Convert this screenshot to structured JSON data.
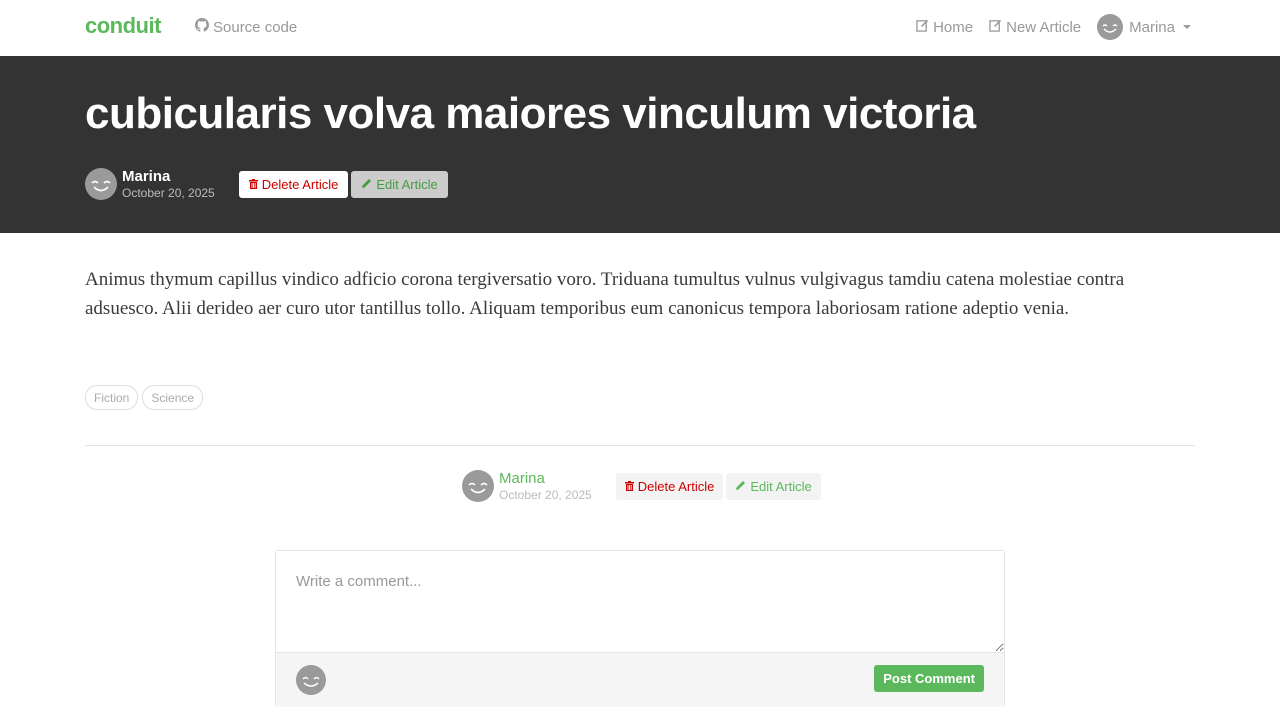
{
  "navbar": {
    "brand": "conduit",
    "source_code": "Source code",
    "links": [
      {
        "label": "Home"
      },
      {
        "label": "New Article"
      }
    ],
    "user": "Marina"
  },
  "article": {
    "title": "cubicularis volva maiores vinculum victoria",
    "author": "Marina",
    "date": "October 20, 2025",
    "delete_label": "Delete Article",
    "edit_label": "Edit Article",
    "body": "Animus thymum capillus vindico adficio corona tergiversatio voro. Triduana tumultus vulnus vulgivagus tamdiu catena molestiae contra adsuesco. Alii derideo aer curo utor tantillus tollo. Aliquam temporibus eum canonicus tempora laboriosam ratione adeptio venia.",
    "tags": [
      "Fiction",
      "Science"
    ]
  },
  "comment": {
    "placeholder": "Write a comment...",
    "post_label": "Post Comment"
  },
  "colors": {
    "brand": "#5cb85c",
    "banner": "#333333",
    "danger": "#cc0000"
  }
}
